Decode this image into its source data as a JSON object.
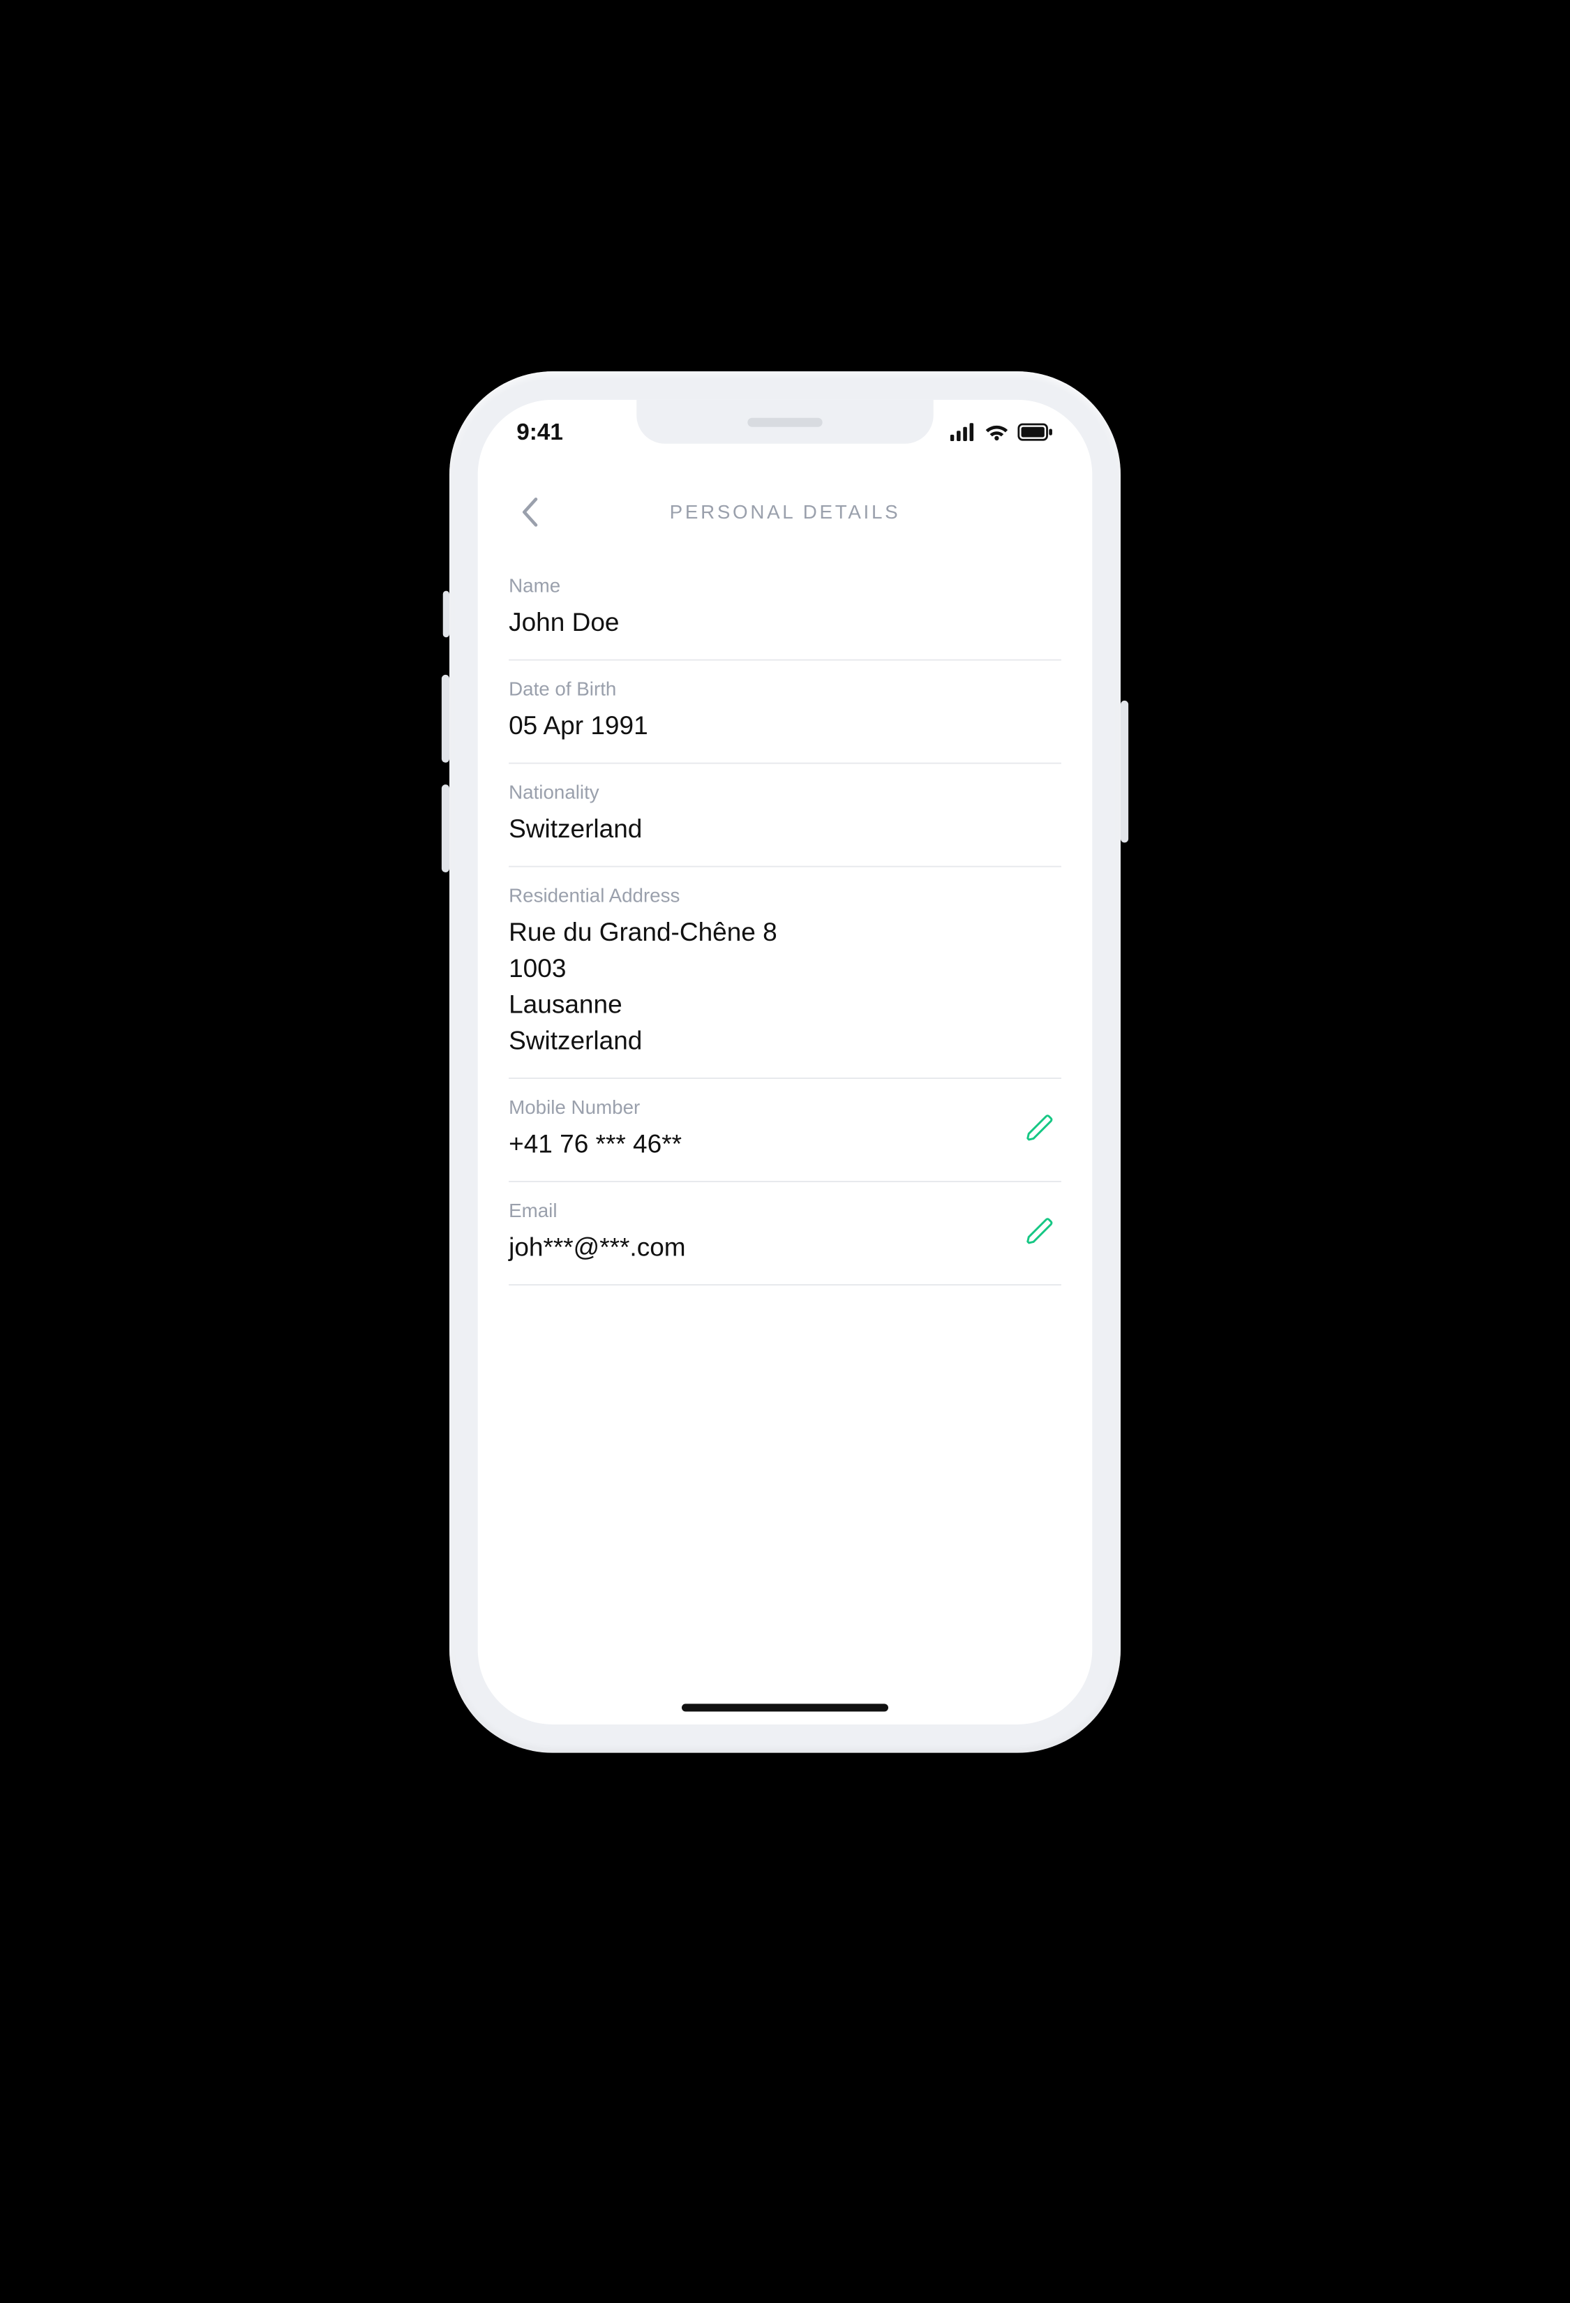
{
  "status": {
    "time": "9:41"
  },
  "header": {
    "title": "PERSONAL DETAILS"
  },
  "fields": {
    "name": {
      "label": "Name",
      "value": "John Doe"
    },
    "dob": {
      "label": "Date of Birth",
      "value": "05 Apr 1991"
    },
    "nationality": {
      "label": "Nationality",
      "value": "Switzerland"
    },
    "address": {
      "label": "Residential Address",
      "line1": "Rue du Grand-Chêne 8",
      "line2": "1003",
      "line3": "Lausanne",
      "line4": "Switzerland"
    },
    "mobile": {
      "label": "Mobile Number",
      "value": "+41 76 *** 46**"
    },
    "email": {
      "label": "Email",
      "value": "joh***@***.com"
    }
  },
  "colors": {
    "accent": "#16c784",
    "muted": "#9aa0ac"
  }
}
